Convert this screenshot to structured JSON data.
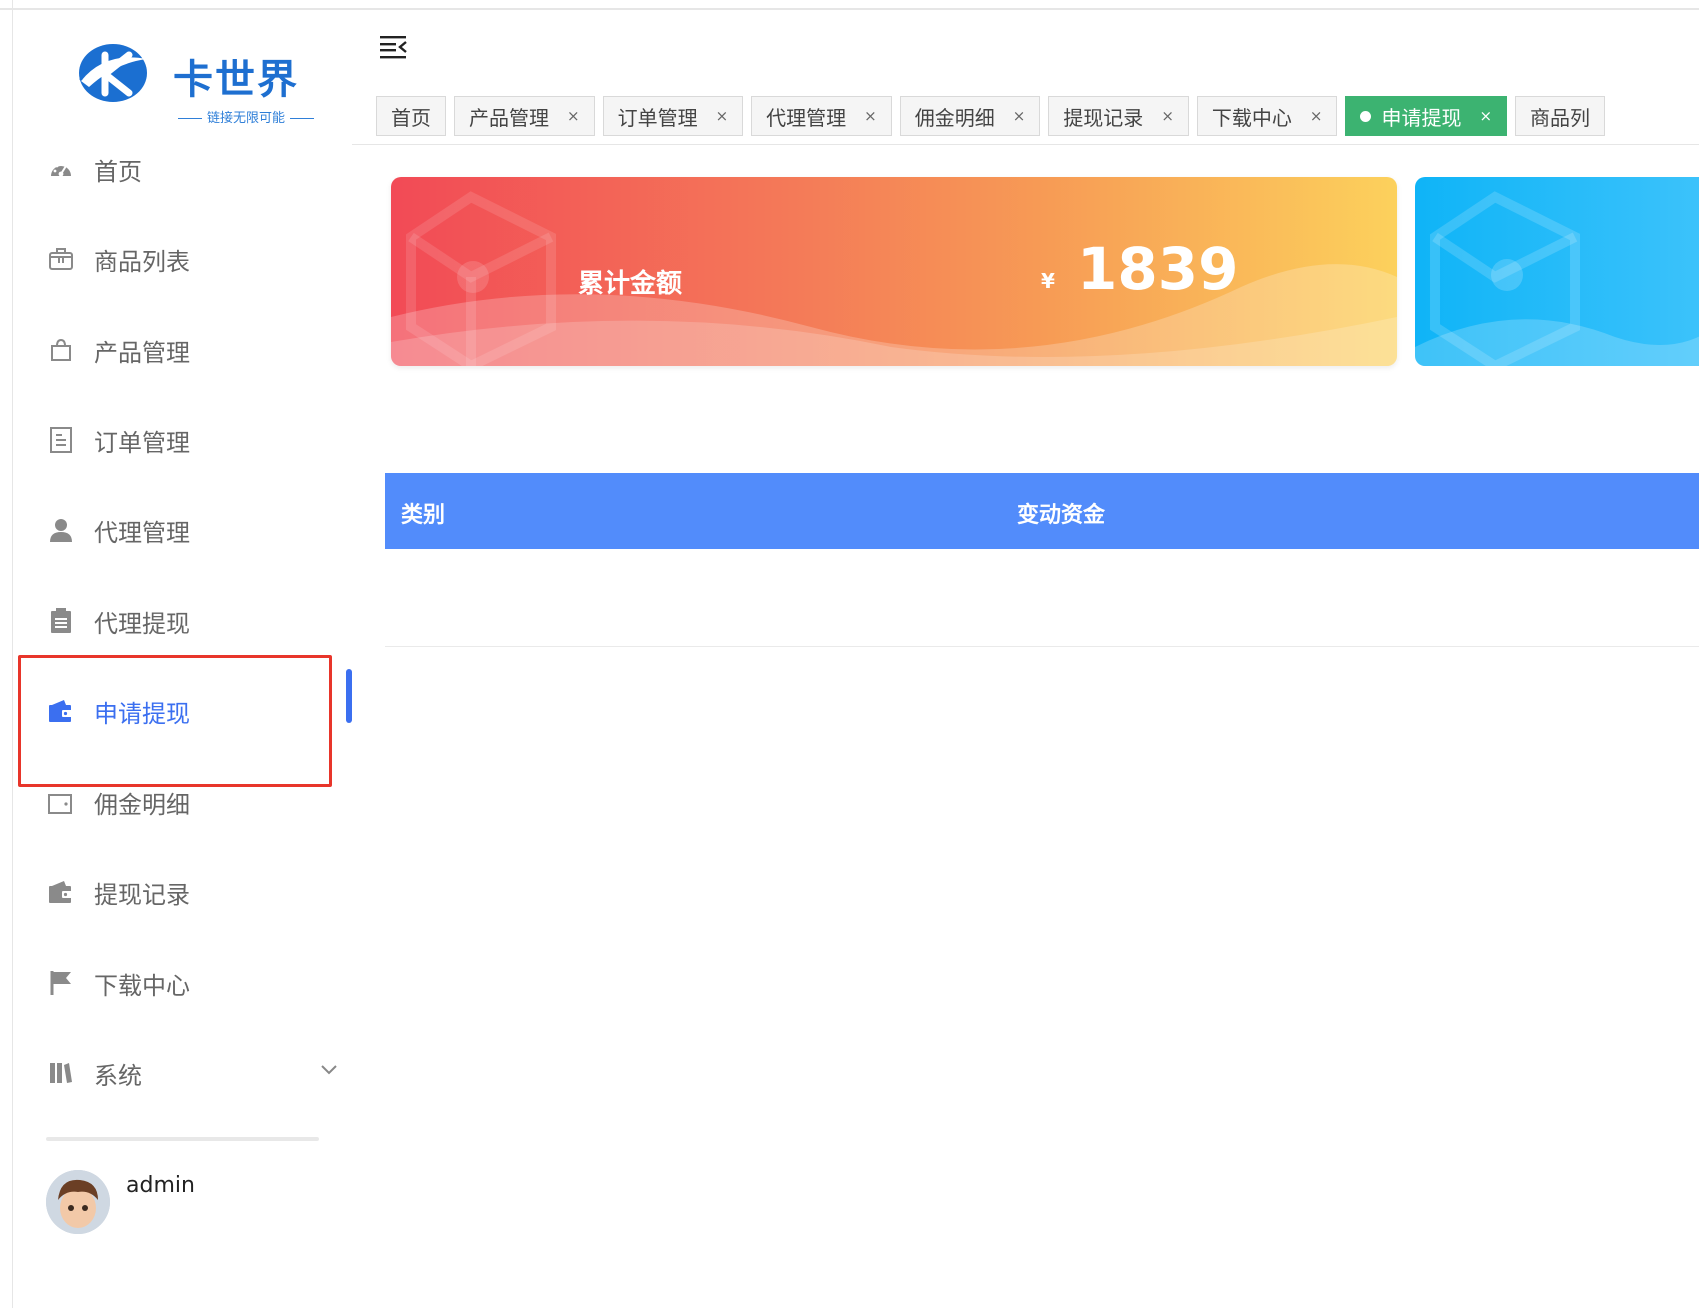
{
  "brand": {
    "name": "卡世界",
    "tagline": "链接无限可能"
  },
  "sidebar": {
    "items": [
      {
        "label": "首页",
        "icon": "dashboard-icon"
      },
      {
        "label": "商品列表",
        "icon": "shop-icon"
      },
      {
        "label": "产品管理",
        "icon": "bag-icon"
      },
      {
        "label": "订单管理",
        "icon": "document-icon"
      },
      {
        "label": "代理管理",
        "icon": "user-icon"
      },
      {
        "label": "代理提现",
        "icon": "clipboard-icon"
      },
      {
        "label": "申请提现",
        "icon": "wallet-icon",
        "active": true
      },
      {
        "label": "佣金明细",
        "icon": "wallet-outline-icon"
      },
      {
        "label": "提现记录",
        "icon": "wallet-icon"
      },
      {
        "label": "下载中心",
        "icon": "flag-icon"
      },
      {
        "label": "系统",
        "icon": "library-icon"
      }
    ],
    "user": {
      "name": "admin"
    }
  },
  "tabs": [
    {
      "label": "首页",
      "closable": false
    },
    {
      "label": "产品管理",
      "closable": true
    },
    {
      "label": "订单管理",
      "closable": true
    },
    {
      "label": "代理管理",
      "closable": true
    },
    {
      "label": "佣金明细",
      "closable": true
    },
    {
      "label": "提现记录",
      "closable": true
    },
    {
      "label": "下载中心",
      "closable": true
    },
    {
      "label": "申请提现",
      "closable": true,
      "active": true
    },
    {
      "label": "商品列",
      "closable": false
    }
  ],
  "tab_close_symbol": "×",
  "summary_card": {
    "label": "累计金额",
    "currency": "¥",
    "value": "1839"
  },
  "table": {
    "columns": [
      "类别",
      "变动资金"
    ]
  },
  "colors": {
    "accent": "#3b6ff0",
    "active_tab": "#3cb371",
    "table_header": "#528cfb",
    "highlight_box": "#e8352a"
  }
}
